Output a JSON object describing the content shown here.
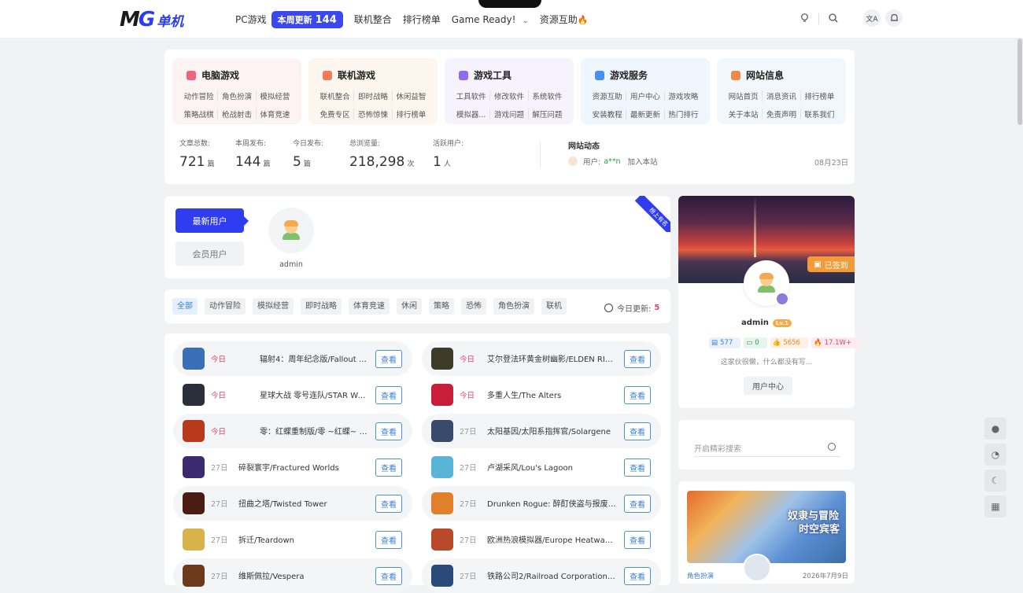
{
  "header": {
    "logo_mg": "MG",
    "logo_cn": "单机",
    "nav": [
      {
        "label": "PC游戏"
      },
      {
        "label": "联机整合"
      },
      {
        "label": "排行榜单"
      },
      {
        "label": "Game Ready!"
      },
      {
        "label": "资源互助"
      }
    ],
    "badge_text": "本周更新",
    "badge_count": "144",
    "icons": [
      "lightbulb-icon",
      "search-icon",
      "translate-icon",
      "bell-icon"
    ]
  },
  "categories": [
    {
      "title": "电脑游戏",
      "color": "#f0637c",
      "bg": "#fdf3f5",
      "items": [
        [
          "动作冒险",
          "角色扮演",
          "模拟经营"
        ],
        [
          "策略战棋",
          "枪战射击",
          "体育竞速"
        ]
      ]
    },
    {
      "title": "联机游戏",
      "color": "#f07a5a",
      "bg": "#fdf6ef",
      "items": [
        [
          "联机整合",
          "即时战略",
          "休闲益智"
        ],
        [
          "免费专区",
          "恐怖惊悚",
          "排行榜单"
        ]
      ]
    },
    {
      "title": "游戏工具",
      "color": "#8e6cf0",
      "bg": "#f6f3fe",
      "items": [
        [
          "工具软件",
          "修改软件",
          "系统软件"
        ],
        [
          "模拟器...",
          "游戏问题",
          "解压问题"
        ]
      ]
    },
    {
      "title": "游戏服务",
      "color": "#4a8ff0",
      "bg": "#f0f6fe",
      "items": [
        [
          "资源互助",
          "用户中心",
          "游戏攻略"
        ],
        [
          "安装教程",
          "最新更新",
          "热门排行"
        ]
      ]
    },
    {
      "title": "网站信息",
      "color": "#f08a4a",
      "bg": "#f1f7fb",
      "items": [
        [
          "网站首页",
          "消息资讯",
          "排行榜单"
        ],
        [
          "关于本站",
          "免责声明",
          "联系我们"
        ]
      ]
    }
  ],
  "stats": [
    {
      "label": "文章总数:",
      "value": "721",
      "unit": "篇"
    },
    {
      "label": "本周发布:",
      "value": "144",
      "unit": "篇"
    },
    {
      "label": "今日发布:",
      "value": "5",
      "unit": "篇"
    },
    {
      "label": "总浏览量:",
      "value": "218,298",
      "unit": "次"
    },
    {
      "label": "活跃用户:",
      "value": "1",
      "unit": "人"
    }
  ],
  "dynamic": {
    "title": "网站动态",
    "prefix": "用户:",
    "user": "a**n",
    "action": "加入本站",
    "date": "08月23日"
  },
  "users": {
    "tab_new": "最新用户",
    "tab_vip": "会员用户",
    "name": "admin",
    "ribbon": "榜上有名"
  },
  "filter": {
    "tabs": [
      "全部",
      "动作冒险",
      "模拟经营",
      "即时战略",
      "体育竞速",
      "休闲",
      "策略",
      "恐怖",
      "角色扮演",
      "联机"
    ],
    "today_label": "今日更新:",
    "today_count": "5"
  },
  "games_left": [
    {
      "date": "今日",
      "title": "辐射4：周年纪念版/Fallout 4 – Ann...",
      "thumb": "#3a6fb5"
    },
    {
      "date": "今日",
      "title": "星球大战 零号连队/STAR WARS Zer...",
      "thumb": "#2a2f3a"
    },
    {
      "date": "今日",
      "title": "零：红蝶重制版/零 ~红蝶~ 重制版...",
      "thumb": "#b8391c"
    },
    {
      "date": "27日",
      "title": "碎裂寰宇/Fractured Worlds",
      "thumb": "#3b2a6e"
    },
    {
      "date": "27日",
      "title": "扭曲之塔/Twisted Tower",
      "thumb": "#4a1c12"
    },
    {
      "date": "27日",
      "title": "拆迁/Teardown",
      "thumb": "#d8b24a"
    },
    {
      "date": "27日",
      "title": "维斯佩拉/Vespera",
      "thumb": "#6a3a1a"
    }
  ],
  "games_right": [
    {
      "date": "今日",
      "title": "艾尔登法环黄金树幽影/ELDEN RING...",
      "thumb": "#3e3a2a"
    },
    {
      "date": "今日",
      "title": "多重人生/The Alters",
      "thumb": "#c81e3a"
    },
    {
      "date": "27日",
      "title": "太阳基因/太阳系指挥官/Solargene",
      "thumb": "#394a6a"
    },
    {
      "date": "27日",
      "title": "卢湖采风/Lou's Lagoon",
      "thumb": "#5ab4d8"
    },
    {
      "date": "27日",
      "title": "Drunken Rogue: 醉酊侠盗与报废吸...",
      "thumb": "#e0802a"
    },
    {
      "date": "27日",
      "title": "欧洲热浪模拟器/Europe Heatwave ...",
      "thumb": "#b84a2a"
    },
    {
      "date": "27日",
      "title": "铁路公司2/Railroad Corporation 2...",
      "thumb": "#2a4a7a"
    }
  ],
  "go_label": "查看",
  "profile": {
    "signed": "已签到",
    "name": "admin",
    "level": "Lv.1",
    "posts": "577",
    "comments": "0",
    "likes": "5656",
    "views": "17.1W+",
    "desc": "这家伙很懒，什么都没有写...",
    "center": "用户中心"
  },
  "search": {
    "placeholder": "开启精彩搜索"
  },
  "banner": {
    "title_line1": "奴隶与冒险",
    "title_line2": "时空宾客",
    "tag": "角色扮演",
    "date": "2026年7月9日"
  }
}
